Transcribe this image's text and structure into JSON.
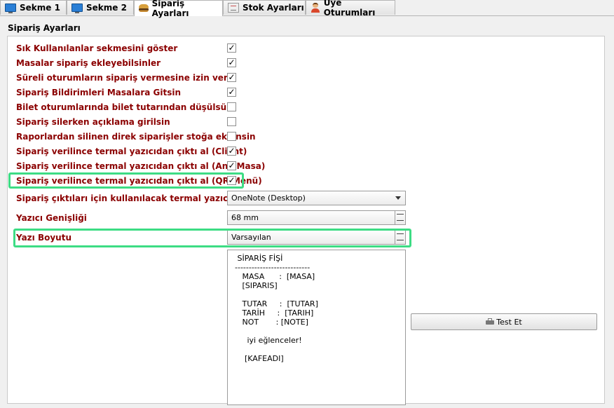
{
  "tabs": [
    {
      "label": "Sekme 1",
      "icon": "monitor-icon"
    },
    {
      "label": "Sekme 2",
      "icon": "monitor-icon"
    },
    {
      "label": "Sipariş Ayarları",
      "icon": "burger-icon"
    },
    {
      "label": "Stok Ayarları",
      "icon": "stock-icon"
    },
    {
      "label": "Üye Oturumları",
      "icon": "user-icon"
    }
  ],
  "active_tab": "Sipariş Ayarları",
  "section_title": "Sipariş Ayarları",
  "settings": [
    {
      "label": "Sık Kullanılanlar sekmesini göster",
      "checked": true
    },
    {
      "label": "Masalar sipariş ekleyebilsinler",
      "checked": true
    },
    {
      "label": "Süreli oturumların sipariş vermesine izin ver",
      "checked": true
    },
    {
      "label": "Sipariş Bildirimleri Masalara Gitsin",
      "checked": true
    },
    {
      "label": "Bilet oturumlarında bilet tutarından düşülsün",
      "checked": false
    },
    {
      "label": "Sipariş silerken açıklama girilsin",
      "checked": false
    },
    {
      "label": "Raporlardan silinen direk siparişler stoğa eklensin",
      "checked": false
    },
    {
      "label": "Sipariş verilince termal yazıcıdan çıktı al (Client)",
      "checked": true
    },
    {
      "label": "Sipariş verilince termal yazıcıdan çıktı al (Ana Masa)",
      "checked": true
    },
    {
      "label": "Sipariş verilince termal yazıcıdan çıktı al (QR Menü)",
      "checked": true
    }
  ],
  "printer": {
    "label": "Sipariş çıktıları için kullanılacak termal yazıcı",
    "value": "OneNote (Desktop)"
  },
  "width": {
    "label": "Yazıcı Genişliği",
    "value": "68 mm"
  },
  "font_size": {
    "label": "Yazı Boyutu",
    "value": "Varsayılan"
  },
  "preview_text": " SİPARİŞ FİŞİ\n---------------------------\n   MASA      :  [MASA]\n   [SIPARIS]\n\n   TUTAR     :  [TUTAR]\n   TARİH     :  [TARIH]\n   NOT       : [NOTE]\n\n     iyi eğlenceler!\n\n    [KAFEADI]",
  "test_button": "Test Et",
  "colors": {
    "label": "#8b0000",
    "highlight": "#3ddc84"
  }
}
